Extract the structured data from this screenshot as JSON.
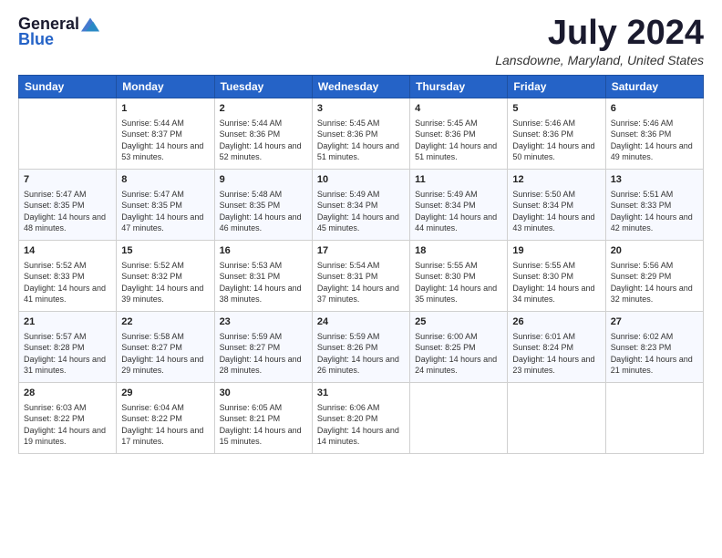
{
  "header": {
    "logo_general": "General",
    "logo_blue": "Blue",
    "title": "July 2024",
    "location": "Lansdowne, Maryland, United States"
  },
  "weekdays": [
    "Sunday",
    "Monday",
    "Tuesday",
    "Wednesday",
    "Thursday",
    "Friday",
    "Saturday"
  ],
  "weeks": [
    [
      {
        "day": "",
        "sunrise": "",
        "sunset": "",
        "daylight": ""
      },
      {
        "day": "1",
        "sunrise": "Sunrise: 5:44 AM",
        "sunset": "Sunset: 8:37 PM",
        "daylight": "Daylight: 14 hours and 53 minutes."
      },
      {
        "day": "2",
        "sunrise": "Sunrise: 5:44 AM",
        "sunset": "Sunset: 8:36 PM",
        "daylight": "Daylight: 14 hours and 52 minutes."
      },
      {
        "day": "3",
        "sunrise": "Sunrise: 5:45 AM",
        "sunset": "Sunset: 8:36 PM",
        "daylight": "Daylight: 14 hours and 51 minutes."
      },
      {
        "day": "4",
        "sunrise": "Sunrise: 5:45 AM",
        "sunset": "Sunset: 8:36 PM",
        "daylight": "Daylight: 14 hours and 51 minutes."
      },
      {
        "day": "5",
        "sunrise": "Sunrise: 5:46 AM",
        "sunset": "Sunset: 8:36 PM",
        "daylight": "Daylight: 14 hours and 50 minutes."
      },
      {
        "day": "6",
        "sunrise": "Sunrise: 5:46 AM",
        "sunset": "Sunset: 8:36 PM",
        "daylight": "Daylight: 14 hours and 49 minutes."
      }
    ],
    [
      {
        "day": "7",
        "sunrise": "Sunrise: 5:47 AM",
        "sunset": "Sunset: 8:35 PM",
        "daylight": "Daylight: 14 hours and 48 minutes."
      },
      {
        "day": "8",
        "sunrise": "Sunrise: 5:47 AM",
        "sunset": "Sunset: 8:35 PM",
        "daylight": "Daylight: 14 hours and 47 minutes."
      },
      {
        "day": "9",
        "sunrise": "Sunrise: 5:48 AM",
        "sunset": "Sunset: 8:35 PM",
        "daylight": "Daylight: 14 hours and 46 minutes."
      },
      {
        "day": "10",
        "sunrise": "Sunrise: 5:49 AM",
        "sunset": "Sunset: 8:34 PM",
        "daylight": "Daylight: 14 hours and 45 minutes."
      },
      {
        "day": "11",
        "sunrise": "Sunrise: 5:49 AM",
        "sunset": "Sunset: 8:34 PM",
        "daylight": "Daylight: 14 hours and 44 minutes."
      },
      {
        "day": "12",
        "sunrise": "Sunrise: 5:50 AM",
        "sunset": "Sunset: 8:34 PM",
        "daylight": "Daylight: 14 hours and 43 minutes."
      },
      {
        "day": "13",
        "sunrise": "Sunrise: 5:51 AM",
        "sunset": "Sunset: 8:33 PM",
        "daylight": "Daylight: 14 hours and 42 minutes."
      }
    ],
    [
      {
        "day": "14",
        "sunrise": "Sunrise: 5:52 AM",
        "sunset": "Sunset: 8:33 PM",
        "daylight": "Daylight: 14 hours and 41 minutes."
      },
      {
        "day": "15",
        "sunrise": "Sunrise: 5:52 AM",
        "sunset": "Sunset: 8:32 PM",
        "daylight": "Daylight: 14 hours and 39 minutes."
      },
      {
        "day": "16",
        "sunrise": "Sunrise: 5:53 AM",
        "sunset": "Sunset: 8:31 PM",
        "daylight": "Daylight: 14 hours and 38 minutes."
      },
      {
        "day": "17",
        "sunrise": "Sunrise: 5:54 AM",
        "sunset": "Sunset: 8:31 PM",
        "daylight": "Daylight: 14 hours and 37 minutes."
      },
      {
        "day": "18",
        "sunrise": "Sunrise: 5:55 AM",
        "sunset": "Sunset: 8:30 PM",
        "daylight": "Daylight: 14 hours and 35 minutes."
      },
      {
        "day": "19",
        "sunrise": "Sunrise: 5:55 AM",
        "sunset": "Sunset: 8:30 PM",
        "daylight": "Daylight: 14 hours and 34 minutes."
      },
      {
        "day": "20",
        "sunrise": "Sunrise: 5:56 AM",
        "sunset": "Sunset: 8:29 PM",
        "daylight": "Daylight: 14 hours and 32 minutes."
      }
    ],
    [
      {
        "day": "21",
        "sunrise": "Sunrise: 5:57 AM",
        "sunset": "Sunset: 8:28 PM",
        "daylight": "Daylight: 14 hours and 31 minutes."
      },
      {
        "day": "22",
        "sunrise": "Sunrise: 5:58 AM",
        "sunset": "Sunset: 8:27 PM",
        "daylight": "Daylight: 14 hours and 29 minutes."
      },
      {
        "day": "23",
        "sunrise": "Sunrise: 5:59 AM",
        "sunset": "Sunset: 8:27 PM",
        "daylight": "Daylight: 14 hours and 28 minutes."
      },
      {
        "day": "24",
        "sunrise": "Sunrise: 5:59 AM",
        "sunset": "Sunset: 8:26 PM",
        "daylight": "Daylight: 14 hours and 26 minutes."
      },
      {
        "day": "25",
        "sunrise": "Sunrise: 6:00 AM",
        "sunset": "Sunset: 8:25 PM",
        "daylight": "Daylight: 14 hours and 24 minutes."
      },
      {
        "day": "26",
        "sunrise": "Sunrise: 6:01 AM",
        "sunset": "Sunset: 8:24 PM",
        "daylight": "Daylight: 14 hours and 23 minutes."
      },
      {
        "day": "27",
        "sunrise": "Sunrise: 6:02 AM",
        "sunset": "Sunset: 8:23 PM",
        "daylight": "Daylight: 14 hours and 21 minutes."
      }
    ],
    [
      {
        "day": "28",
        "sunrise": "Sunrise: 6:03 AM",
        "sunset": "Sunset: 8:22 PM",
        "daylight": "Daylight: 14 hours and 19 minutes."
      },
      {
        "day": "29",
        "sunrise": "Sunrise: 6:04 AM",
        "sunset": "Sunset: 8:22 PM",
        "daylight": "Daylight: 14 hours and 17 minutes."
      },
      {
        "day": "30",
        "sunrise": "Sunrise: 6:05 AM",
        "sunset": "Sunset: 8:21 PM",
        "daylight": "Daylight: 14 hours and 15 minutes."
      },
      {
        "day": "31",
        "sunrise": "Sunrise: 6:06 AM",
        "sunset": "Sunset: 8:20 PM",
        "daylight": "Daylight: 14 hours and 14 minutes."
      },
      {
        "day": "",
        "sunrise": "",
        "sunset": "",
        "daylight": ""
      },
      {
        "day": "",
        "sunrise": "",
        "sunset": "",
        "daylight": ""
      },
      {
        "day": "",
        "sunrise": "",
        "sunset": "",
        "daylight": ""
      }
    ]
  ]
}
